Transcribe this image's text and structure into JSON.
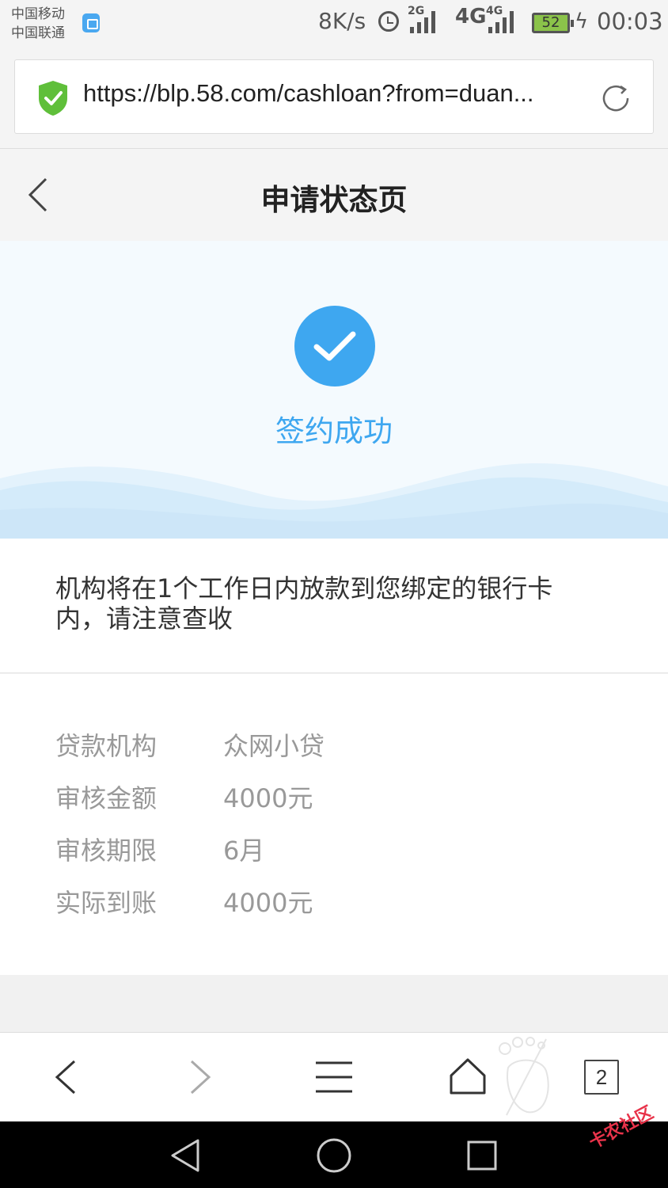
{
  "status_bar": {
    "carrier_1": "中国移动",
    "carrier_2": "中国联通",
    "net_speed": "8K/s",
    "net_2g": "2G",
    "net_4g_large": "4G",
    "net_4g_small": "4G",
    "battery_level": "52",
    "time": "00:03"
  },
  "browser": {
    "url": "https://blp.58.com/cashloan?from=duan...",
    "tab_count": "2"
  },
  "page": {
    "title": "申请状态页",
    "status_text": "签约成功",
    "notice_line_1": "机构将在1个工作日内放款到您绑定的银行卡",
    "notice_line_2": "内，请注意查收"
  },
  "details": [
    {
      "label": "贷款机构",
      "value": "众网小贷"
    },
    {
      "label": "审核金额",
      "value": "4000元"
    },
    {
      "label": "审核期限",
      "value": "6月"
    },
    {
      "label": "实际到账",
      "value": "4000元"
    }
  ],
  "watermark": "卡农社区",
  "colors": {
    "accent": "#3ea7f0",
    "shield": "#5fbf3a",
    "battery": "#8bc34a"
  }
}
